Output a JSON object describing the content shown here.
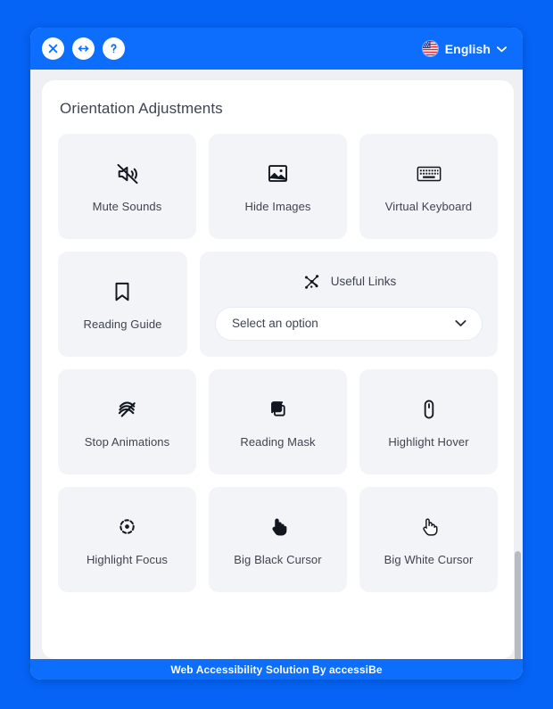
{
  "header": {
    "buttons": [
      {
        "name": "close",
        "icon": "close-icon",
        "title": "Close"
      },
      {
        "name": "move",
        "icon": "move-horizontal-icon",
        "title": "Move"
      },
      {
        "name": "help",
        "icon": "question-mark-icon",
        "title": "Help"
      }
    ],
    "language": {
      "label": "English",
      "flag": "us-flag-icon",
      "caret": "⌄"
    },
    "background_color": "#0d6efd"
  },
  "main": {
    "title": "Orientation Adjustments",
    "rows": [
      {
        "tiles": [
          {
            "label": "Mute Sounds",
            "icon": "mute-sounds-icon"
          },
          {
            "label": "Hide Images",
            "icon": "hide-images-icon"
          },
          {
            "label": "Virtual Keyboard",
            "icon": "virtual-keyboard-icon"
          }
        ]
      },
      {
        "tiles": [
          {
            "label": "Reading Guide",
            "icon": "reading-guide-icon"
          }
        ],
        "links_card": {
          "label": "Useful Links",
          "icon": "useful-links-icon",
          "select": {
            "value": "Select an option",
            "caret": "⌄"
          }
        }
      },
      {
        "tiles": [
          {
            "label": "Stop Animations",
            "icon": "stop-animations-icon"
          },
          {
            "label": "Reading Mask",
            "icon": "reading-mask-icon"
          },
          {
            "label": "Highlight Hover",
            "icon": "highlight-hover-icon"
          }
        ]
      },
      {
        "tiles": [
          {
            "label": "Highlight Focus",
            "icon": "highlight-focus-icon"
          },
          {
            "label": "Big Black Cursor",
            "icon": "big-black-cursor-icon"
          },
          {
            "label": "Big White Cursor",
            "icon": "big-white-cursor-icon"
          }
        ]
      }
    ]
  },
  "footer": {
    "text": "Web Accessibility Solution By accessiBe",
    "background_color": "#0d6efd"
  },
  "colors": {
    "page_background": "#0563f5",
    "panel_background": "#eef0f4",
    "tile_background": "#f2f4f8",
    "text": "#3f4450",
    "scrollbar_thumb": "#b7bcc4"
  }
}
